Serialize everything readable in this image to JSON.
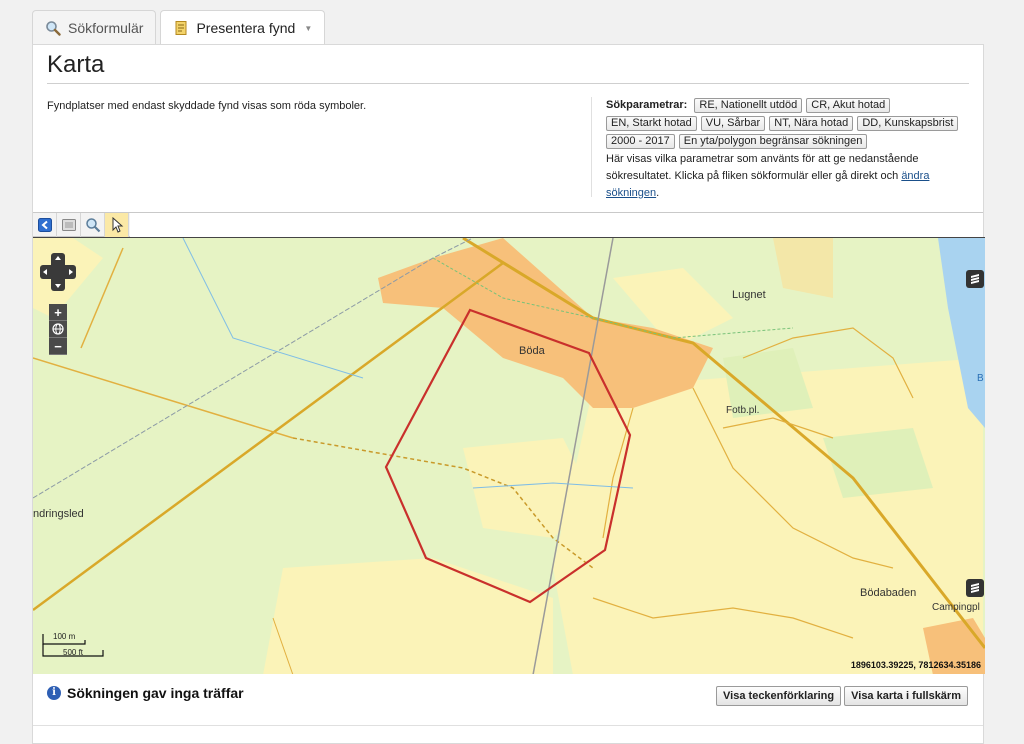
{
  "tabs": [
    {
      "label": "Sökformulär",
      "icon": "magnifier-icon",
      "active": false
    },
    {
      "label": "Presentera fynd",
      "icon": "document-icon",
      "active": true
    }
  ],
  "page": {
    "title": "Karta",
    "note": "Fyndplatser med endast skyddade fynd visas som röda symboler."
  },
  "search_params": {
    "label": "Sökparametrar:",
    "chips": [
      "RE, Nationellt utdöd",
      "CR, Akut hotad",
      "EN, Starkt hotad",
      "VU, Sårbar",
      "NT, Nära hotad",
      "DD, Kunskapsbrist",
      "2000 - 2017",
      "En yta/polygon begränsar sökningen"
    ],
    "desc": "Här visas vilka parametrar som använts för att ge nedanstående sökresultatet. Klicka på fliken sökformulär eller gå direkt och",
    "link": "ändra sökningen",
    "tail": "."
  },
  "map_toolbar": [
    "back-arrow-icon",
    "full-extent-icon",
    "zoom-in-icon",
    "pointer-icon"
  ],
  "map": {
    "labels": {
      "boda": "Böda",
      "lugnet": "Lugnet",
      "fotb": "Fotb.pl.",
      "vandringsled": "ndringsled",
      "bodabaden": "Bödabaden",
      "campingpl": "Campingpl",
      "water_b": "B"
    },
    "scale": {
      "metric": "100 m",
      "imperial": "500 ft"
    },
    "coordinates": "1896103.39225, 7812634.35186",
    "zoom": {
      "in": "+",
      "out": "−"
    }
  },
  "result": {
    "message": "Sökningen gav inga träffar",
    "legend_button": "Visa teckenförklaring",
    "fullscreen_button": "Visa karta i fullskärm"
  },
  "colors": {
    "polygon": "#c9302c",
    "urban": "#f7c07a",
    "field": "#fbf3b8",
    "forest": "#e6f3c4",
    "water": "#a9d3f0",
    "road": "#d9a829"
  }
}
